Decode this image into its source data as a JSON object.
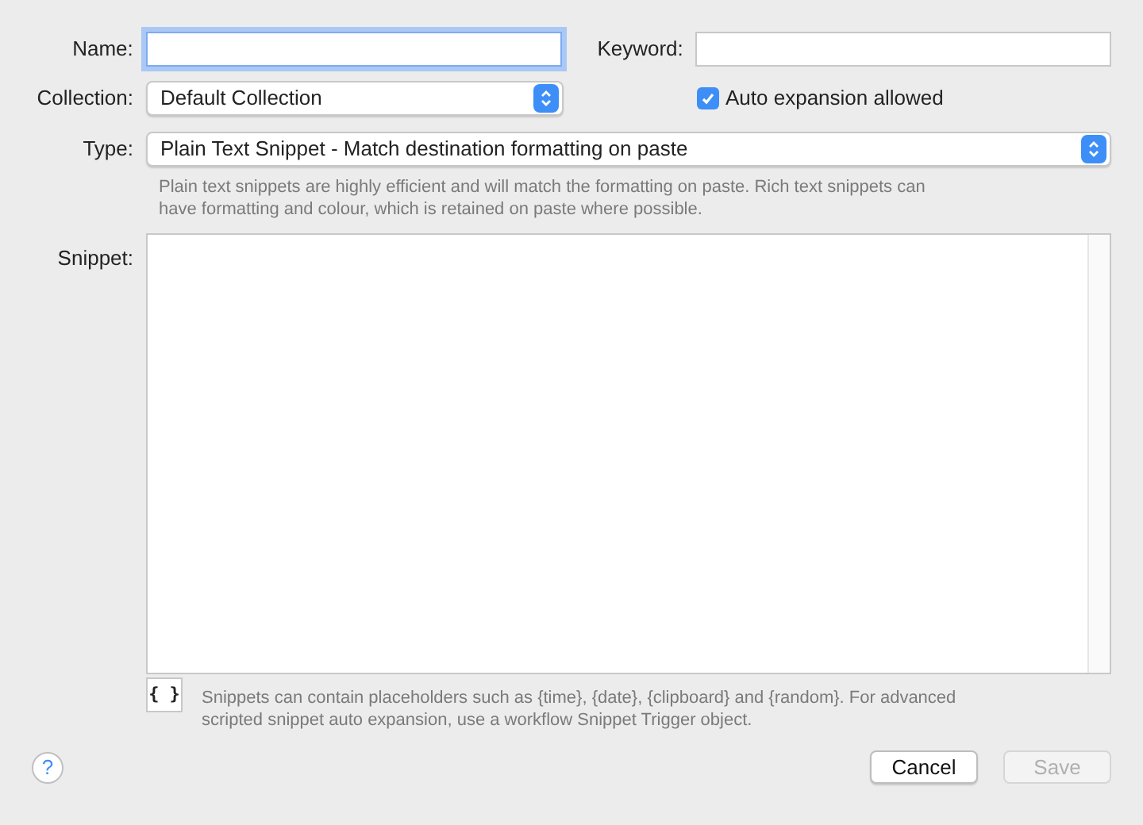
{
  "name_field": {
    "label": "Name:",
    "focused": true
  },
  "keyword_field": {
    "label": "Keyword:"
  },
  "collection": {
    "label": "Collection:",
    "value": "Default Collection"
  },
  "auto_expansion": {
    "label": "Auto expansion allowed",
    "checked": true
  },
  "type": {
    "label": "Type:",
    "value": "Plain Text Snippet - Match destination formatting on paste",
    "help": "Plain text snippets are highly efficient and will match the formatting on paste. Rich text snippets can have formatting and colour, which is retained on paste where possible."
  },
  "snippet": {
    "label": "Snippet:",
    "placeholder_button": "{ }",
    "help": "Snippets can contain placeholders such as {time}, {date}, {clipboard} and {random}. For advanced scripted snippet auto expansion, use a workflow Snippet Trigger object."
  },
  "help_button": "?",
  "buttons": [
    {
      "label": "Cancel",
      "disabled": false
    },
    {
      "label": "Save",
      "disabled": true
    }
  ]
}
